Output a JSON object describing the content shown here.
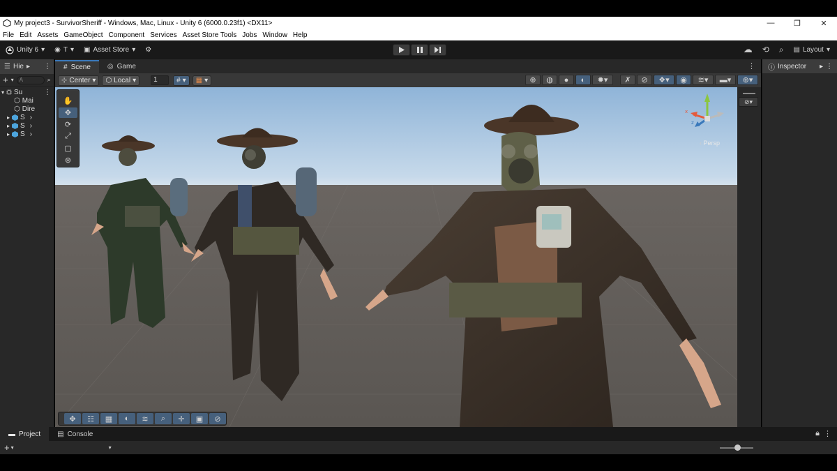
{
  "window": {
    "title": "My project3 - SurvivorSheriff - Windows, Mac, Linux - Unity 6 (6000.0.23f1) <DX11>",
    "minimize": "—",
    "maximize": "❐",
    "close": "✕"
  },
  "menu": [
    "File",
    "Edit",
    "Assets",
    "GameObject",
    "Component",
    "Services",
    "Asset Store Tools",
    "Jobs",
    "Window",
    "Help"
  ],
  "toolbar": {
    "unity_version": "Unity 6",
    "account_label": "T",
    "asset_store": "Asset Store",
    "layout": "Layout"
  },
  "hierarchy": {
    "tab": "Hie",
    "search_placeholder": "A",
    "scene_name": "Su",
    "items": [
      "Mai",
      "Dire",
      "S",
      "S",
      "S"
    ]
  },
  "scene_view": {
    "tabs": [
      "Scene",
      "Game"
    ],
    "pivot": "Center",
    "space": "Local",
    "grid_value": "1",
    "persp_label": "Persp"
  },
  "inspector": {
    "tab": "Inspector"
  },
  "bottom": {
    "tabs": [
      "Project",
      "Console"
    ]
  },
  "colors": {
    "accent_blue": "#3a79bb",
    "active_tool": "#46607c",
    "panel": "#282828",
    "toolbar": "#191919"
  }
}
